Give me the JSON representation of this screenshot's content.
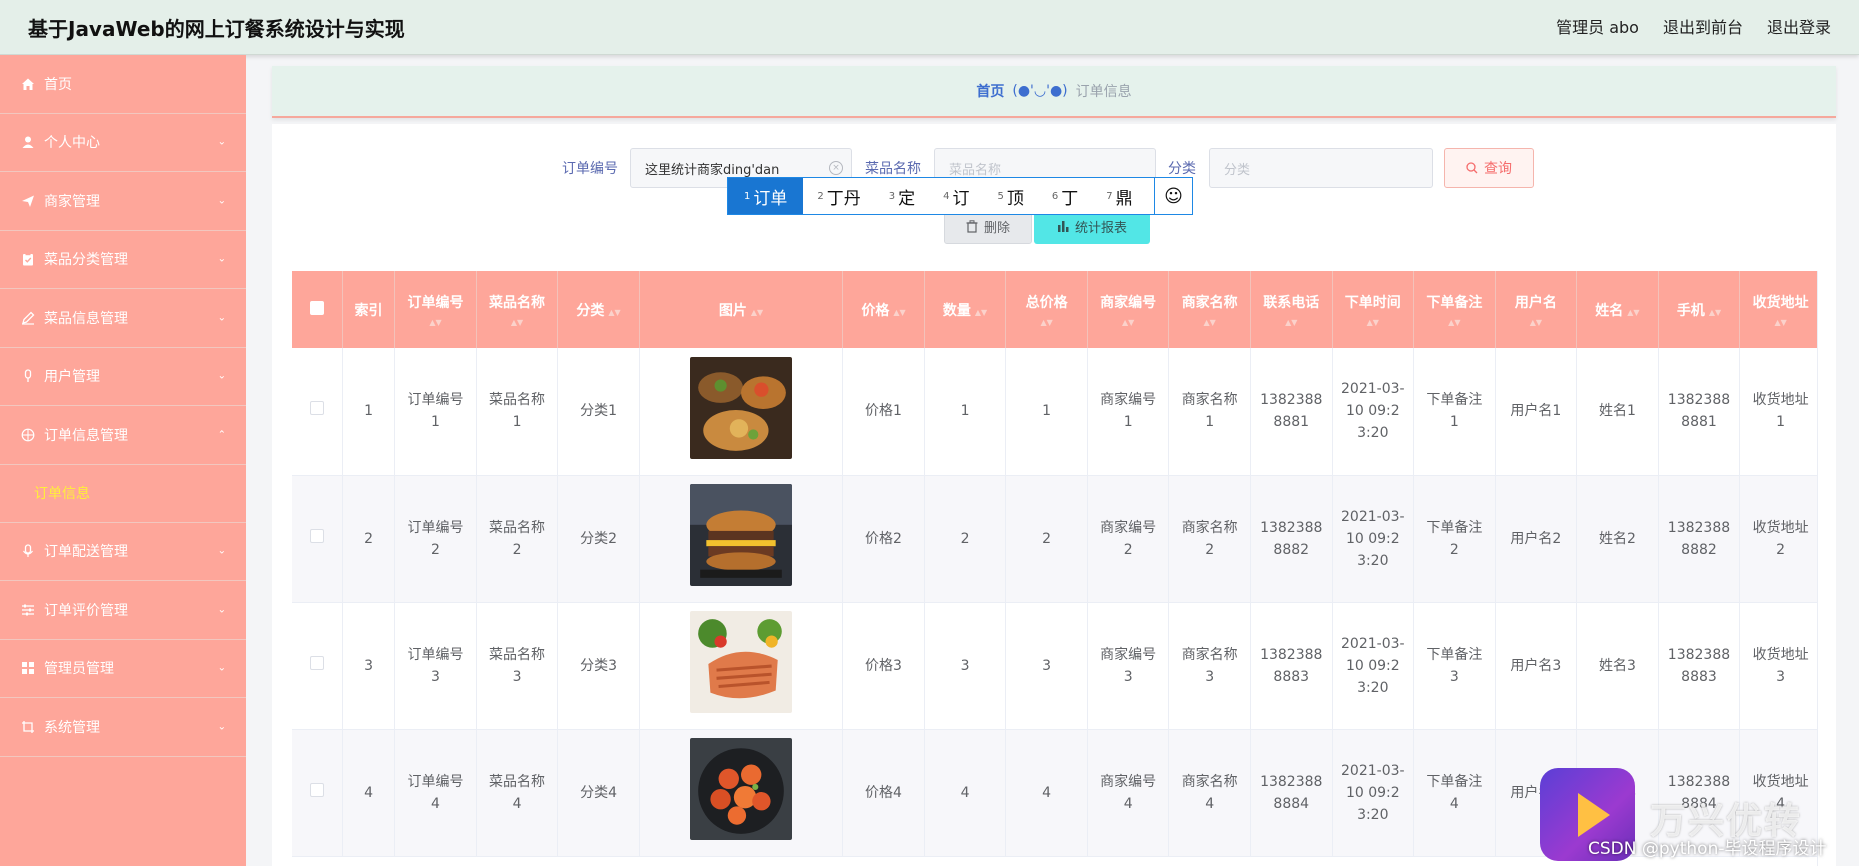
{
  "header": {
    "title": "基于JavaWeb的网上订餐系统设计与实现",
    "user": "管理员 abo",
    "to_front": "退出到前台",
    "logout": "退出登录"
  },
  "sidebar": {
    "items": [
      {
        "label": "首页",
        "icon": "home-icon",
        "expandable": false
      },
      {
        "label": "个人中心",
        "icon": "user-icon",
        "expandable": true
      },
      {
        "label": "商家管理",
        "icon": "send-icon",
        "expandable": true
      },
      {
        "label": "菜品分类管理",
        "icon": "clipboard-icon",
        "expandable": true
      },
      {
        "label": "菜品信息管理",
        "icon": "edit-icon",
        "expandable": true
      },
      {
        "label": "用户管理",
        "icon": "mic-icon",
        "expandable": true
      },
      {
        "label": "订单信息管理",
        "icon": "globe-icon",
        "expandable": true,
        "expanded": true
      },
      {
        "label": "订单配送管理",
        "icon": "mic-icon",
        "expandable": true
      },
      {
        "label": "订单评价管理",
        "icon": "sliders-icon",
        "expandable": true
      },
      {
        "label": "管理员管理",
        "icon": "grid-icon",
        "expandable": true
      },
      {
        "label": "系统管理",
        "icon": "crop-icon",
        "expandable": true
      }
    ],
    "submenu_active": "订单信息"
  },
  "breadcrumb": {
    "home": "首页",
    "sep": "(●'◡'●)",
    "current": "订单信息"
  },
  "search": {
    "order_no_label": "订单编号",
    "order_no_value": "这里统计商家ding'dan",
    "dish_label": "菜品名称",
    "dish_placeholder": "菜品名称",
    "category_label": "分类",
    "category_placeholder": "分类",
    "query_label": "查询"
  },
  "ime": {
    "candidates": [
      {
        "num": "1",
        "text": "订单"
      },
      {
        "num": "2",
        "text": "丁丹"
      },
      {
        "num": "3",
        "text": "定"
      },
      {
        "num": "4",
        "text": "订"
      },
      {
        "num": "5",
        "text": "顶"
      },
      {
        "num": "6",
        "text": "丁"
      },
      {
        "num": "7",
        "text": "鼎"
      }
    ],
    "emoji": "☺"
  },
  "actions": {
    "delete_label": "删除",
    "stats_label": "统计报表"
  },
  "table": {
    "columns": [
      "索引",
      "订单编号",
      "菜品名称",
      "分类",
      "图片",
      "价格",
      "数量",
      "总价格",
      "商家编号",
      "商家名称",
      "联系电话",
      "下单时间",
      "下单备注",
      "用户名",
      "姓名",
      "手机",
      "收货地址"
    ],
    "rows": [
      {
        "index": "1",
        "order_no": "订单编号1",
        "dish": "菜品名称1",
        "category": "分类1",
        "image": "food-photo-1",
        "price": "价格1",
        "qty": "1",
        "total": "1",
        "shop_no": "商家编号1",
        "shop_name": "商家名称1",
        "phone": "13823888881",
        "time": "2021-03-10 09:23:20",
        "note": "下单备注1",
        "username": "用户名1",
        "name": "姓名1",
        "mobile": "13823888881",
        "address": "收货地址1"
      },
      {
        "index": "2",
        "order_no": "订单编号2",
        "dish": "菜品名称2",
        "category": "分类2",
        "image": "food-photo-2",
        "price": "价格2",
        "qty": "2",
        "total": "2",
        "shop_no": "商家编号2",
        "shop_name": "商家名称2",
        "phone": "13823888882",
        "time": "2021-03-10 09:23:20",
        "note": "下单备注2",
        "username": "用户名2",
        "name": "姓名2",
        "mobile": "13823888882",
        "address": "收货地址2"
      },
      {
        "index": "3",
        "order_no": "订单编号3",
        "dish": "菜品名称3",
        "category": "分类3",
        "image": "food-photo-3",
        "price": "价格3",
        "qty": "3",
        "total": "3",
        "shop_no": "商家编号3",
        "shop_name": "商家名称3",
        "phone": "13823888883",
        "time": "2021-03-10 09:23:20",
        "note": "下单备注3",
        "username": "用户名3",
        "name": "姓名3",
        "mobile": "13823888883",
        "address": "收货地址3"
      },
      {
        "index": "4",
        "order_no": "订单编号4",
        "dish": "菜品名称4",
        "category": "分类4",
        "image": "food-photo-4",
        "price": "价格4",
        "qty": "4",
        "total": "4",
        "shop_no": "商家编号4",
        "shop_name": "商家名称4",
        "phone": "13823888884",
        "time": "2021-03-10 09:23:20",
        "note": "下单备注4",
        "username": "用户名4",
        "name": "姓名4",
        "mobile": "13823888884",
        "address": "收货地址4"
      }
    ]
  },
  "watermark": {
    "brand": "万兴优转",
    "csdn": "CSDN @python-毕设程序设计"
  },
  "colors": {
    "sidebar_bg": "#fea69a",
    "header_bg": "#e4efe9",
    "accent": "#52e6e6",
    "active_submenu": "#ffef3a"
  }
}
